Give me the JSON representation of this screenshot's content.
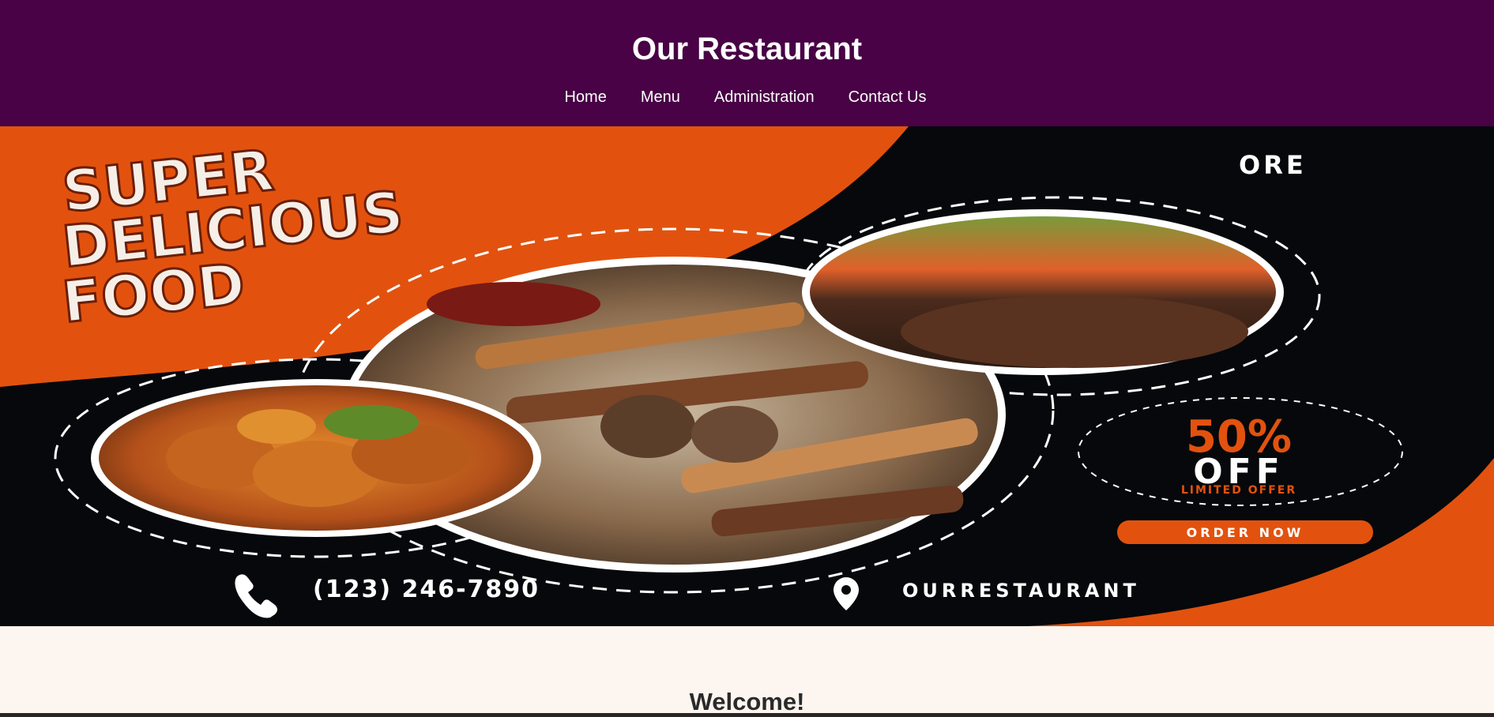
{
  "header": {
    "title": "Our Restaurant",
    "background": "#480245",
    "nav": [
      {
        "label": "Home"
      },
      {
        "label": "Menu"
      },
      {
        "label": "Administration"
      },
      {
        "label": "Contact Us"
      }
    ]
  },
  "hero": {
    "headline_line1": "SUPER",
    "headline_line2": "DELICIOUS",
    "headline_line3": "FOOD",
    "brand_partial": "ORE",
    "discount": "50%",
    "discount_word": "OFF",
    "offer_note": "LIMITED OFFER",
    "order_button": "ORDER NOW",
    "phone": "(123) 246-7890",
    "location": "OURRESTAURANT",
    "phone_icon": "phone-icon",
    "location_icon": "location-pin-icon",
    "accent_color": "#e2520e",
    "dark_color": "#06080b"
  },
  "welcome": {
    "heading": "Welcome!"
  }
}
